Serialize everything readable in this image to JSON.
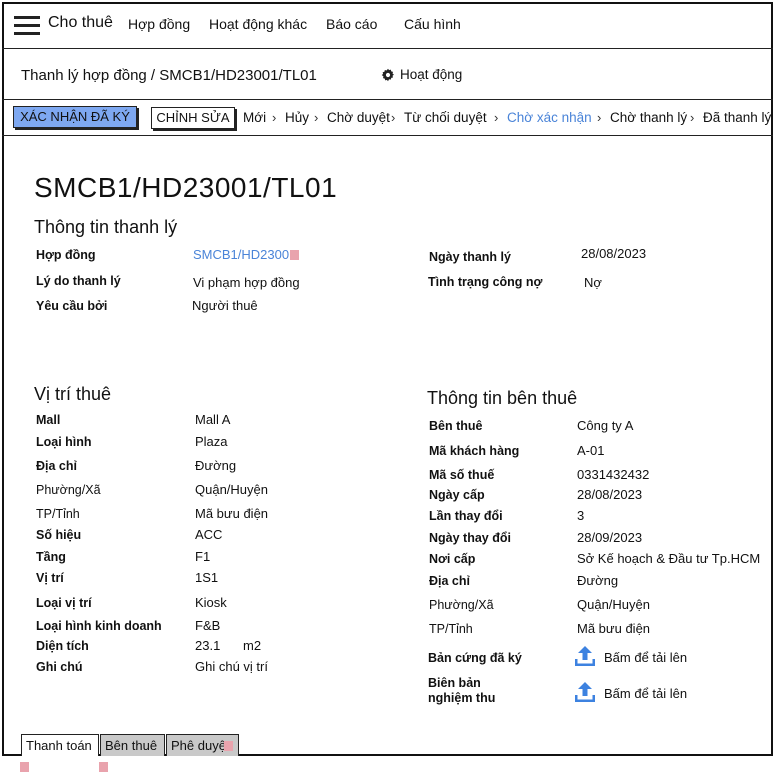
{
  "nav": {
    "app_title": "Cho thuê",
    "items": [
      "Hợp đồng",
      "Hoạt động khác",
      "Báo cáo",
      "Cấu hình"
    ]
  },
  "header": {
    "breadcrumb": "Thanh lý hợp đồng / SMCB1/HD23001/TL01",
    "activity_label": "Hoạt động"
  },
  "actions": {
    "confirm_label": "XÁC NHẬN ĐÃ KÝ",
    "edit_label": "CHỈNH SỬA"
  },
  "statusbar": {
    "steps": [
      "Mới",
      "Hủy",
      "Chờ duyệt",
      "Từ chối duyệt",
      "Chờ xác nhận",
      "Chờ thanh lý",
      "Đã thanh lý"
    ],
    "active_step": "Chờ xác nhận"
  },
  "record": {
    "title": "SMCB1/HD23001/TL01"
  },
  "liquidation": {
    "heading": "Thông tin thanh lý",
    "contract_label": "Hợp đồng",
    "contract_value": "SMCB1/HD23001",
    "reason_label": "Lý do thanh lý",
    "reason_value": "Vi phạm hợp đồng",
    "requested_label": "Yêu cầu bởi",
    "requested_value": "Người thuê",
    "date_label": "Ngày thanh lý",
    "date_value": "28/08/2023",
    "debt_label": "Tình trạng công nợ",
    "debt_value": "Nợ"
  },
  "location": {
    "heading": "Vị trí thuê",
    "rows": [
      {
        "label": "Mall",
        "value": "Mall A"
      },
      {
        "label": "Loại hình",
        "value": "Plaza"
      },
      {
        "label": "Địa chỉ",
        "value": "Đường"
      },
      {
        "label": "Phường/Xã",
        "value": "Quận/Huyện"
      },
      {
        "label": "TP/Tỉnh",
        "value": "Mã bưu điện"
      },
      {
        "label": "Số hiệu",
        "value": "ACC"
      },
      {
        "label": "Tầng",
        "value": "F1"
      },
      {
        "label": "Vị trí",
        "value": "1S1"
      },
      {
        "label": "Loại vị trí",
        "value": "Kiosk"
      },
      {
        "label": "Loại hình kinh doanh",
        "value": "F&B"
      },
      {
        "label": "Diện tích",
        "value": "23.1",
        "unit": "m2"
      },
      {
        "label": "Ghi chú",
        "value": "Ghi chú vị trí"
      }
    ]
  },
  "tenant": {
    "heading": "Thông tin bên thuê",
    "rows": [
      {
        "label": "Bên thuê",
        "value": "Công ty A"
      },
      {
        "label": "Mã khách hàng",
        "value": "A-01"
      },
      {
        "label": "Mã số thuế",
        "value": "0331432432"
      },
      {
        "label": "Ngày cấp",
        "value": "28/08/2023"
      },
      {
        "label": "Lần thay đổi",
        "value": "3"
      },
      {
        "label": "Ngày thay đổi",
        "value": "28/09/2023"
      },
      {
        "label": "Nơi cấp",
        "value": "Sở Kế hoạch & Đầu tư Tp.HCM"
      },
      {
        "label": "Địa chỉ",
        "value": "Đường"
      },
      {
        "label": "Phường/Xã",
        "value": "Quận/Huyện"
      },
      {
        "label": "TP/Tỉnh",
        "value": "Mã bưu điện"
      }
    ],
    "signed_copy_label": "Bản cứng đã ký",
    "acceptance_label_1": "Biên bản",
    "acceptance_label_2": "nghiệm thu",
    "upload_label": "Bấm để tải lên"
  },
  "tabs": [
    "Thanh toán",
    "Bên thuê",
    "Phê duyệt"
  ],
  "colors": {
    "accent": "#4a84d8",
    "confirm_button": "#7ea8f1",
    "tab_inactive": "#c9c9c9"
  }
}
